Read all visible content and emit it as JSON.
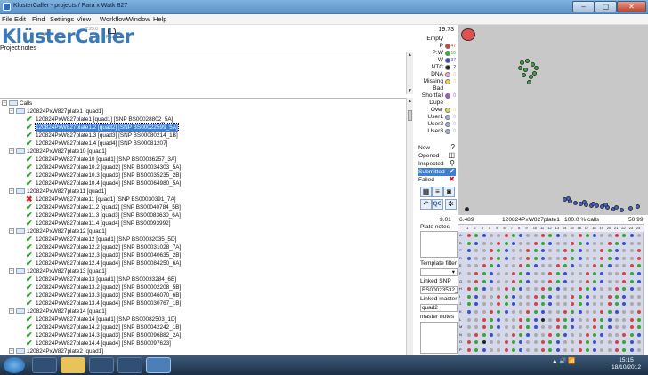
{
  "window": {
    "title": "KlusterCaller - projects / Para x Watk 827"
  },
  "menu": [
    "File",
    "Edit",
    "Find",
    "Settings",
    "View",
    "Workflow",
    "Window",
    "Help"
  ],
  "logo": {
    "name": "KlüsterCaller",
    "version": "2.23.0",
    "progress_label": "Progress"
  },
  "project_notes_label": "Project notes",
  "tree": {
    "root": "Calls",
    "groups": [
      {
        "name": "120824PxW827plate1 [quad1]",
        "items": [
          {
            "status": "check",
            "label": "120824PxW827plate1 [quad1] [SNP BS00028802_5A]"
          },
          {
            "status": "check",
            "label": "120824PxW827plate1.2 [quad2] [SNP BS00022599_5A]",
            "selected": true
          },
          {
            "status": "check",
            "label": "120824PxW827plate1.3 [quad3] [SNP BS00080214_1B]"
          },
          {
            "status": "check",
            "label": "120824PxW827plate1.4 [quad4] [SNP BS00081207]"
          }
        ]
      },
      {
        "name": "120824PxW827plate10 [quad1]",
        "items": [
          {
            "status": "check",
            "label": "120824PxW827plate10 [quad1] [SNP BS00036257_3A]"
          },
          {
            "status": "check",
            "label": "120824PxW827plate10.2 [quad2] [SNP BS00034303_5A]"
          },
          {
            "status": "check",
            "label": "120824PxW827plate10.3 [quad3] [SNP BS00035235_2B]"
          },
          {
            "status": "check",
            "label": "120824PxW827plate10.4 [quad4] [SNP BS00064980_5A]"
          }
        ]
      },
      {
        "name": "120824PxW827plate11 [quad1]",
        "items": [
          {
            "status": "cross",
            "label": "120824PxW827plate11 [quad1] [SNP BS00030391_7A]"
          },
          {
            "status": "check",
            "label": "120824PxW827plate11.2 [quad2] [SNP BS00040784_5B]"
          },
          {
            "status": "check",
            "label": "120824PxW827plate11.3 [quad3] [SNP BS00083630_6A]"
          },
          {
            "status": "check",
            "label": "120824PxW827plate11.4 [quad4] [SNP BS00093992]"
          }
        ]
      },
      {
        "name": "120824PxW827plate12 [quad1]",
        "items": [
          {
            "status": "check",
            "label": "120824PxW827plate12 [quad1] [SNP BS00032035_5D]"
          },
          {
            "status": "check",
            "label": "120824PxW827plate12.2 [quad2] [SNP BS00031028_7A]"
          },
          {
            "status": "check",
            "label": "120824PxW827plate12.3 [quad3] [SNP BS00040635_2B]"
          },
          {
            "status": "check",
            "label": "120824PxW827plate12.4 [quad4] [SNP BS00084250_6A]"
          }
        ]
      },
      {
        "name": "120824PxW827plate13 [quad1]",
        "items": [
          {
            "status": "check",
            "label": "120824PxW827plate13 [quad1] [SNP BS00033284_6B]"
          },
          {
            "status": "check",
            "label": "120824PxW827plate13.2 [quad2] [SNP BS00002208_5B]"
          },
          {
            "status": "check",
            "label": "120824PxW827plate13.3 [quad3] [SNP BS00046070_6B]"
          },
          {
            "status": "check",
            "label": "120824PxW827plate13.4 [quad4] [SNP BS00030767_1B]"
          }
        ]
      },
      {
        "name": "120824PxW827plate14 [quad1]",
        "items": [
          {
            "status": "check",
            "label": "120824PxW827plate14 [quad1] [SNP BS00082503_1D]"
          },
          {
            "status": "check",
            "label": "120824PxW827plate14.2 [quad2] [SNP BS00042242_1B]"
          },
          {
            "status": "check",
            "label": "120824PxW827plate14.3 [quad3] [SNP BS00096882_2A]"
          },
          {
            "status": "check",
            "label": "120824PxW827plate14.4 [quad4] [SNP BS00097623]"
          }
        ]
      },
      {
        "name": "120824PxW827plate2 [quad1]",
        "items": [
          {
            "status": "check",
            "label": "120824PxW827plate2 [quad1] [SNP BS00020197_5B]"
          }
        ]
      }
    ]
  },
  "top_value": "19.73",
  "categories": [
    {
      "label": "Empty",
      "color": "#bdbdbd",
      "count": ""
    },
    {
      "label": "P",
      "color": "#e03c3c",
      "count": "47"
    },
    {
      "label": "P:W",
      "color": "#33b233",
      "count": "10"
    },
    {
      "label": "W",
      "color": "#2c4bd6",
      "count": "37"
    },
    {
      "label": "NTC",
      "color": "#222222",
      "count": "2"
    },
    {
      "label": "DNA",
      "color": "#e8a8d8",
      "count": "0"
    },
    {
      "label": "Missing",
      "color": "#e8d24a",
      "count": "0"
    },
    {
      "label": "Bad",
      "color": "#ffffff",
      "count": ""
    },
    {
      "label": "Shortfall",
      "color": "#a05ad0",
      "count": "0"
    },
    {
      "label": "Dupe",
      "color": "#ffffff",
      "count": ""
    },
    {
      "label": "Over",
      "color": "#d8d860",
      "count": "0"
    },
    {
      "label": "User1",
      "color": "#9ab0d8",
      "count": "0"
    },
    {
      "label": "User2",
      "color": "#9ab0d8",
      "count": "0"
    },
    {
      "label": "User3",
      "color": "#9ab0d8",
      "count": "0"
    }
  ],
  "statuses": [
    {
      "label": "New",
      "icon": "?"
    },
    {
      "label": "Opened",
      "icon": "◫"
    },
    {
      "label": "Inspected",
      "icon": "⚲"
    },
    {
      "label": "Submitted",
      "icon": "✔",
      "active": true
    },
    {
      "label": "Failed",
      "icon": "✖"
    }
  ],
  "tool_labels": {
    "qc": "QC"
  },
  "bottom_value": "3.01",
  "plate_notes_label": "Plate notes",
  "template_filter_label": "Template filter",
  "linked_snp_label": "Linked SNP",
  "linked_snp_value": "BS00023532_",
  "linked_master_label": "Linked master",
  "linked_master_value": "quad2",
  "master_notes_label": "master notes",
  "scatter_stats": {
    "left": "6.489",
    "plate": "120824PxW827plate1",
    "calls": "100.0 % calls",
    "right": "50.99"
  },
  "plate_rows": [
    "A",
    "B",
    "C",
    "D",
    "E",
    "F",
    "G",
    "H",
    "I",
    "J",
    "K",
    "L",
    "M",
    "N",
    "O",
    "P"
  ],
  "plate_well_colors": [
    "#d24444",
    "#3c4fcf",
    "#aaaaaa",
    "#33a833",
    "#222222"
  ],
  "clock": {
    "time": "15:15",
    "date": "18/10/2012"
  },
  "tray_text": "▲ 🔊 📶"
}
